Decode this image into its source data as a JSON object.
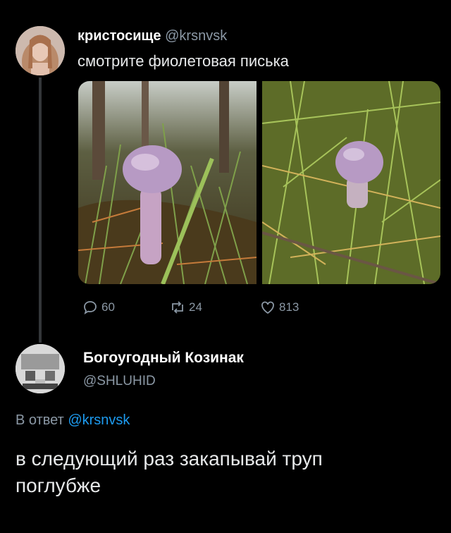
{
  "tweet": {
    "author_name": "кристосище",
    "author_handle": "@krsnvsk",
    "text": "смотрите фиолетовая писька",
    "stats": {
      "replies": "60",
      "retweets": "24",
      "likes": "813"
    }
  },
  "reply": {
    "author_name": "Богоугодный Козинак",
    "author_handle": "@SHLUHID",
    "reply_prefix": "В ответ",
    "reply_to_handle": "@krsnvsk",
    "text_line1": "в следующий раз закапывай труп",
    "text_line2": "поглубже"
  },
  "colors": {
    "background": "#000000",
    "muted": "#8b98a5",
    "link": "#1d9bf0",
    "mushroom": "#b79ac4"
  },
  "icons": [
    "reply-icon",
    "retweet-icon",
    "like-icon"
  ]
}
